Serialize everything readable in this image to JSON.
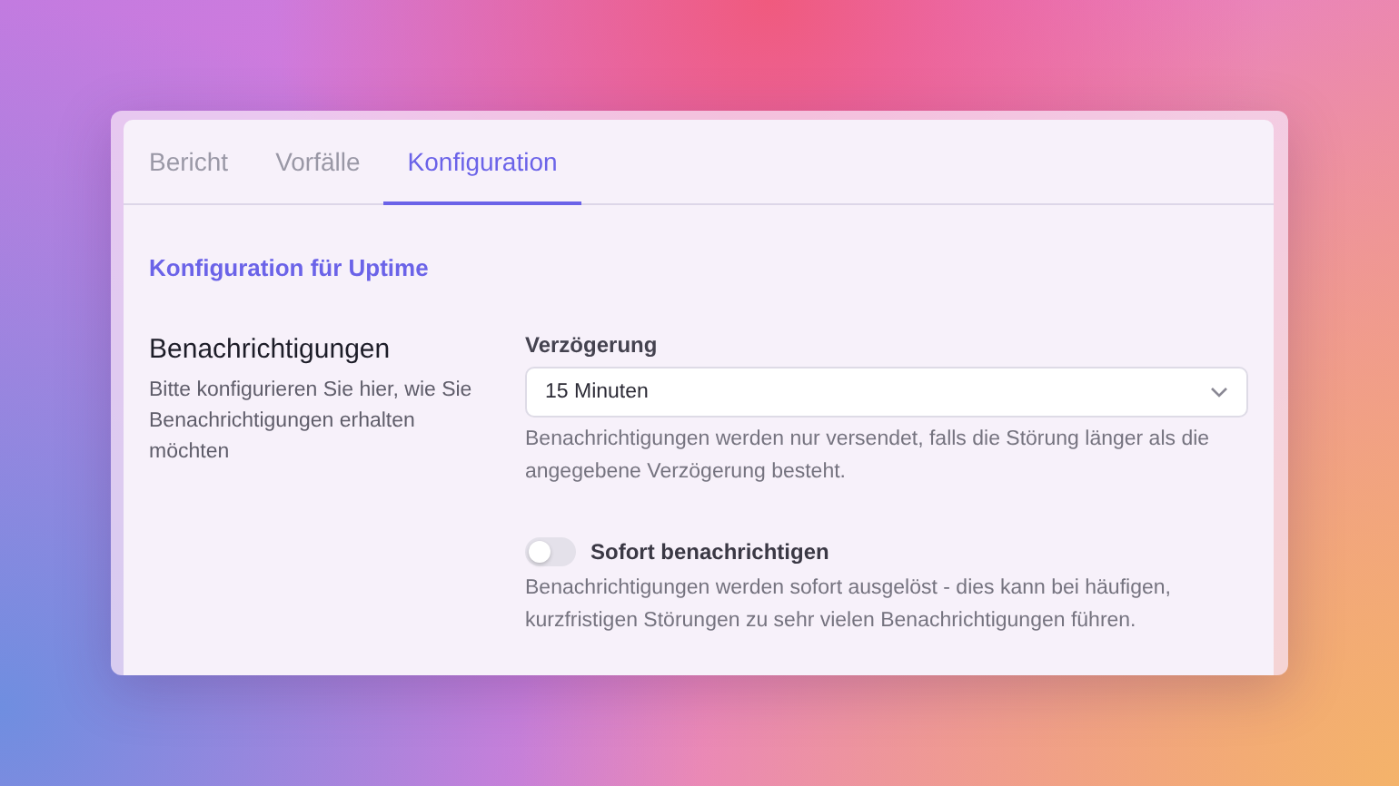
{
  "tabs": [
    {
      "label": "Bericht",
      "selected": false
    },
    {
      "label": "Vorfälle",
      "selected": false
    },
    {
      "label": "Konfiguration",
      "selected": true
    }
  ],
  "heading": "Konfiguration für Uptime",
  "section": {
    "title": "Benachrichtigungen",
    "description": "Bitte konfigurieren Sie hier, wie Sie Benachrichtigungen erhalten möchten"
  },
  "delay": {
    "label": "Verzögerung",
    "value": "15 Minuten",
    "help": "Benachrichtigungen werden nur versendet, falls die Störung länger als die angegebene Verzögerung besteht."
  },
  "instant": {
    "label": "Sofort benachrichtigen",
    "on": false,
    "help": "Benachrichtigungen werden sofort ausgelöst - dies kann bei häufigen, kurzfristigen Störungen zu sehr vielen Benachrichtigungen führen."
  }
}
